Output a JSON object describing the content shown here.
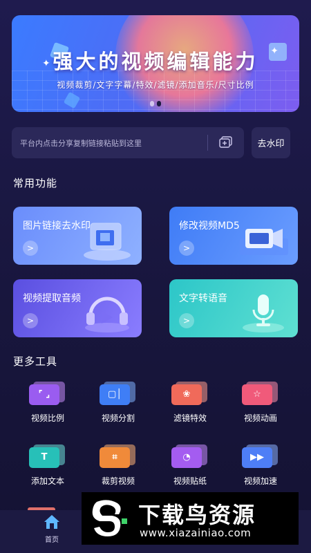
{
  "banner": {
    "title": "强大的视频编辑能力",
    "subtitle": "视频裁剪/文字字幕/特效/滤镜/添加音乐/尺寸比例",
    "pager_count": 2,
    "pager_active": 1
  },
  "link_input": {
    "placeholder": "平台内点击分享复制链接粘贴到这里",
    "value": ""
  },
  "remove_watermark_button": "去水印",
  "common_section": {
    "title": "常用功能",
    "cards": [
      {
        "label": "图片链接去水印"
      },
      {
        "label": "修改视频MD5"
      },
      {
        "label": "视频提取音频"
      },
      {
        "label": "文字转语音"
      }
    ]
  },
  "more_section": {
    "title": "更多工具",
    "tools": [
      {
        "label": "视频比例",
        "icon": "aspect-ratio-icon",
        "color": "#9a5cf0"
      },
      {
        "label": "视频分割",
        "icon": "split-icon",
        "color": "#3f7ef6"
      },
      {
        "label": "滤镜特效",
        "icon": "filter-icon",
        "color": "#f06a5a"
      },
      {
        "label": "视频动画",
        "icon": "star-animation-icon",
        "color": "#f05a7a"
      },
      {
        "label": "添加文本",
        "icon": "text-icon",
        "color": "#27c0b8"
      },
      {
        "label": "裁剪视频",
        "icon": "crop-icon",
        "color": "#f08a3a"
      },
      {
        "label": "视频贴纸",
        "icon": "sticker-icon",
        "color": "#a45cf0"
      },
      {
        "label": "视频加速",
        "icon": "speed-icon",
        "color": "#4e7ef6"
      }
    ]
  },
  "bottom_nav": {
    "home_label": "首页",
    "accent": "#5fb8ff"
  },
  "watermark": {
    "title": "下载鸟资源",
    "url": "www.xiazainiao.com"
  }
}
